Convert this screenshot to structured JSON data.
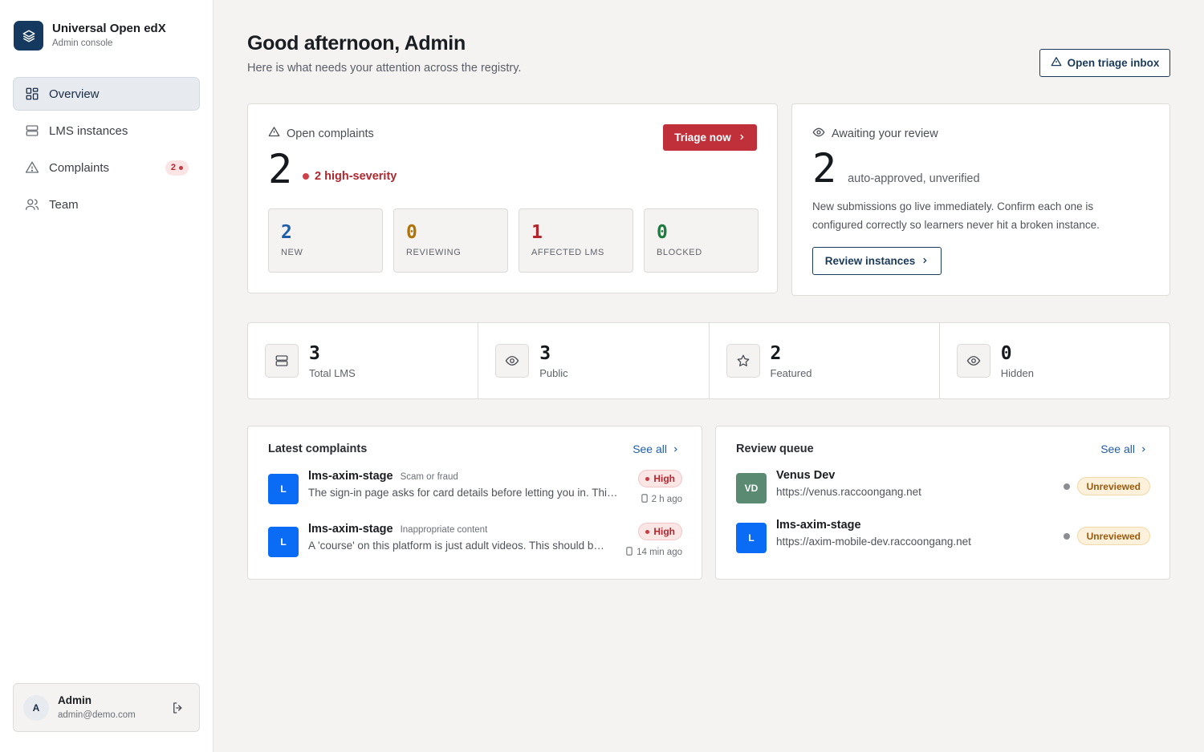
{
  "brand": {
    "title": "Universal Open edX",
    "subtitle": "Admin console"
  },
  "sidebar": {
    "items": [
      {
        "label": "Overview",
        "icon": "grid-icon",
        "active": true
      },
      {
        "label": "LMS instances",
        "icon": "server-icon"
      },
      {
        "label": "Complaints",
        "icon": "warning-icon",
        "badge": "2"
      },
      {
        "label": "Team",
        "icon": "users-icon"
      }
    ]
  },
  "user": {
    "initial": "A",
    "name": "Admin",
    "email": "admin@demo.com"
  },
  "header": {
    "greeting": "Good afternoon, Admin",
    "subtitle": "Here is what needs your attention across the registry.",
    "triage_inbox_label": "Open triage inbox"
  },
  "complaints": {
    "label": "Open complaints",
    "count": "2",
    "high_severity": "2 high-severity",
    "triage_label": "Triage now",
    "stats": [
      {
        "value": "2",
        "label": "NEW",
        "color": "#1f5ea8"
      },
      {
        "value": "0",
        "label": "REVIEWING",
        "color": "#b0720a"
      },
      {
        "value": "1",
        "label": "AFFECTED LMS",
        "color": "#b3262e"
      },
      {
        "value": "0",
        "label": "BLOCKED",
        "color": "#1e7a3e"
      }
    ]
  },
  "review": {
    "label": "Awaiting your review",
    "count": "2",
    "count_sub": "auto-approved, unverified",
    "description": "New submissions go live immediately. Confirm each one is configured correctly so learners never hit a broken instance.",
    "button_label": "Review instances"
  },
  "metrics": [
    {
      "value": "3",
      "label": "Total LMS",
      "icon": "server-icon"
    },
    {
      "value": "3",
      "label": "Public",
      "icon": "eye-icon"
    },
    {
      "value": "2",
      "label": "Featured",
      "icon": "star-icon"
    },
    {
      "value": "0",
      "label": "Hidden",
      "icon": "eye-icon"
    }
  ],
  "latest_complaints": {
    "title": "Latest complaints",
    "see_all": "See all",
    "items": [
      {
        "initial": "L",
        "name": "lms-axim-stage",
        "category": "Scam or fraud",
        "description": "The sign-in page asks for card details before letting you in. This looks like phishing.",
        "severity": "High",
        "time": "2 h ago"
      },
      {
        "initial": "L",
        "name": "lms-axim-stage",
        "category": "Inappropriate content",
        "description": "A 'course' on this platform is just adult videos. This should be removed.",
        "severity": "High",
        "time": "14 min ago"
      }
    ]
  },
  "review_queue": {
    "title": "Review queue",
    "see_all": "See all",
    "items": [
      {
        "initial": "VD",
        "name": "Venus Dev",
        "url": "https://venus.raccoongang.net",
        "status": "Unreviewed",
        "avatar_color": "#5a8a72"
      },
      {
        "initial": "L",
        "name": "lms-axim-stage",
        "url": "https://axim-mobile-dev.raccoongang.net",
        "status": "Unreviewed",
        "avatar_color": "#0a6cf5"
      }
    ]
  },
  "colors": {
    "accent": "#1a3a5c",
    "danger": "#c0303a",
    "lms_avatar": "#0a6cf5"
  }
}
